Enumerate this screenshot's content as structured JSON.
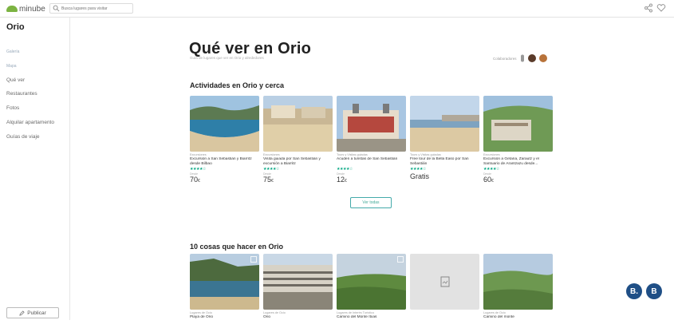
{
  "topbar": {
    "logo_text": "minube",
    "search_placeholder": "Busca lugares para visitar"
  },
  "sidebar": {
    "title": "Orio",
    "items": [
      {
        "label": "Galería",
        "faded": true
      },
      {
        "label": "Mapa",
        "faded": true
      },
      {
        "label": "Qué ver",
        "faded": false
      },
      {
        "label": "Restaurantes",
        "faded": false
      },
      {
        "label": "Fotos",
        "faded": false
      },
      {
        "label": "Alquilar apartamento",
        "faded": false
      },
      {
        "label": "Guías de viaje",
        "faded": false
      }
    ],
    "publish_label": "Publicar"
  },
  "header": {
    "title": "Qué ver en Orio",
    "subtitle": "Guía de lugares que ver en Orio y alrededores",
    "contributors_label": "Colaboradores"
  },
  "activities": {
    "title": "Actividades en Orio y cerca",
    "cards": [
      {
        "category": "Excursiones",
        "name": "Excursión a San Sebastián y Biarritz desde Bilbao",
        "stars": "★★★★☆",
        "from": "Desde",
        "price": "70",
        "unit": "€"
      },
      {
        "category": "Excursiones",
        "name": "Visita guiada por San Sebastián y excursión a Biarritz",
        "stars": "★★★★☆",
        "from": "Desde",
        "price": "75",
        "unit": "€"
      },
      {
        "category": "Tours y Visitas guiadas",
        "name": "Acuden a turistas de San Sebastián",
        "stars": "★★★★☆",
        "from": "Desde",
        "price": "12",
        "unit": "€"
      },
      {
        "category": "Tours y Visitas guiadas",
        "name": "Free tour de la Bella Easo por San Sebastián",
        "stars": "★★★★☆",
        "from": "",
        "price": "Gratis",
        "unit": ""
      },
      {
        "category": "Excursiones",
        "name": "Excursión a Getaria, Zarautz y el Santuario de Arantzazu desde...",
        "stars": "★★★★☆",
        "from": "Desde",
        "price": "60",
        "unit": "€"
      }
    ],
    "view_all_label": "Ver todas"
  },
  "things": {
    "title": "10 cosas que hacer en Orio",
    "cards": [
      {
        "category": "Lugares de Ocio",
        "name": "Playa de Orio"
      },
      {
        "category": "Lugares de Ocio",
        "name": "Orio"
      },
      {
        "category": "Lugares de Interés Turístico",
        "name": "Camino del Monte Itxas"
      },
      {
        "category": "",
        "name": ""
      },
      {
        "category": "Lugares de Ocio",
        "name": "Camino del monte"
      }
    ]
  },
  "bubbles": [
    "B.",
    "B"
  ],
  "colors": {
    "accent": "#00a680",
    "brand": "#7cb342",
    "bubble": "#1f4f86"
  }
}
